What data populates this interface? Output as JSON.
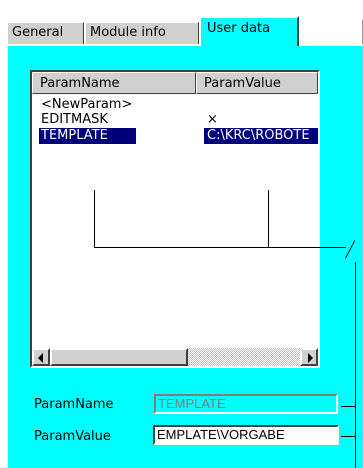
{
  "tabs": [
    {
      "label": "General"
    },
    {
      "label": "Module info"
    },
    {
      "label": "User data",
      "active": true
    }
  ],
  "list": {
    "columns": [
      "ParamName",
      "ParamValue"
    ],
    "rows": [
      {
        "name": "<NewParam>",
        "value": ""
      },
      {
        "name": "EDITMASK",
        "value": "×"
      },
      {
        "name": "TEMPLATE",
        "value": "C:\\KRC\\ROBOTE",
        "selected": true
      }
    ]
  },
  "fields": {
    "param_name": {
      "label": "ParamName",
      "value": "TEMPLATE",
      "enabled": false
    },
    "param_value": {
      "label": "ParamValue",
      "value": "EMPLATE\\VORGABE",
      "enabled": true
    }
  },
  "colors": {
    "page_background": "#00ffff",
    "selection": "#00007c",
    "chrome": "#d0d0d0"
  }
}
